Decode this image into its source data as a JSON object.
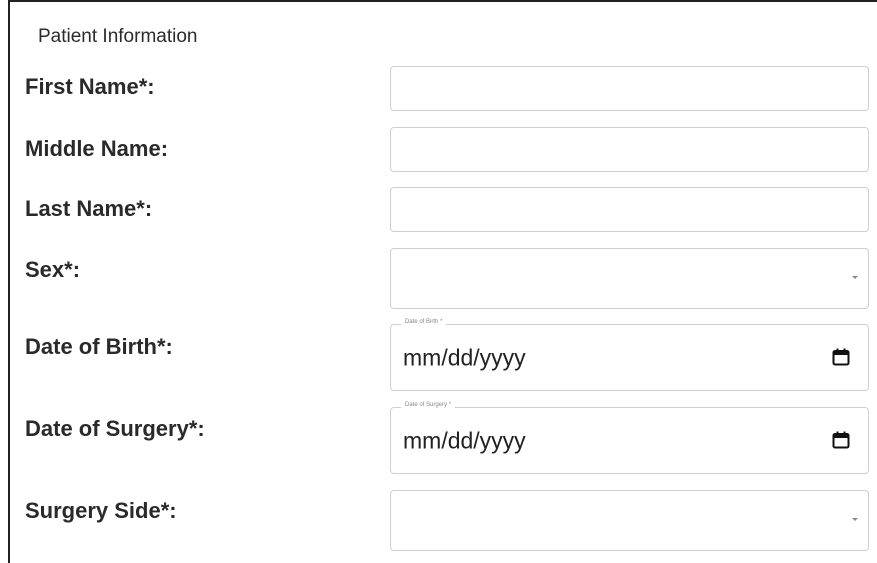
{
  "section": {
    "title": "Patient Information"
  },
  "fields": {
    "first_name": {
      "label": "First Name*:",
      "value": ""
    },
    "middle_name": {
      "label": "Middle Name:",
      "value": ""
    },
    "last_name": {
      "label": "Last Name*:",
      "value": ""
    },
    "sex": {
      "label": "Sex*:",
      "value": ""
    },
    "date_of_birth": {
      "label": "Date of Birth*:",
      "floating_label": "Date of Birth *",
      "value": "mm/dd/yyyy"
    },
    "date_of_surgery": {
      "label": "Date of Surgery*:",
      "floating_label": "Date of Surgery *",
      "value": "mm/dd/yyyy"
    },
    "surgery_side": {
      "label": "Surgery Side*:",
      "value": ""
    }
  },
  "icons": {
    "calendar": "calendar-icon",
    "dropdown": "chevron-down-icon"
  }
}
